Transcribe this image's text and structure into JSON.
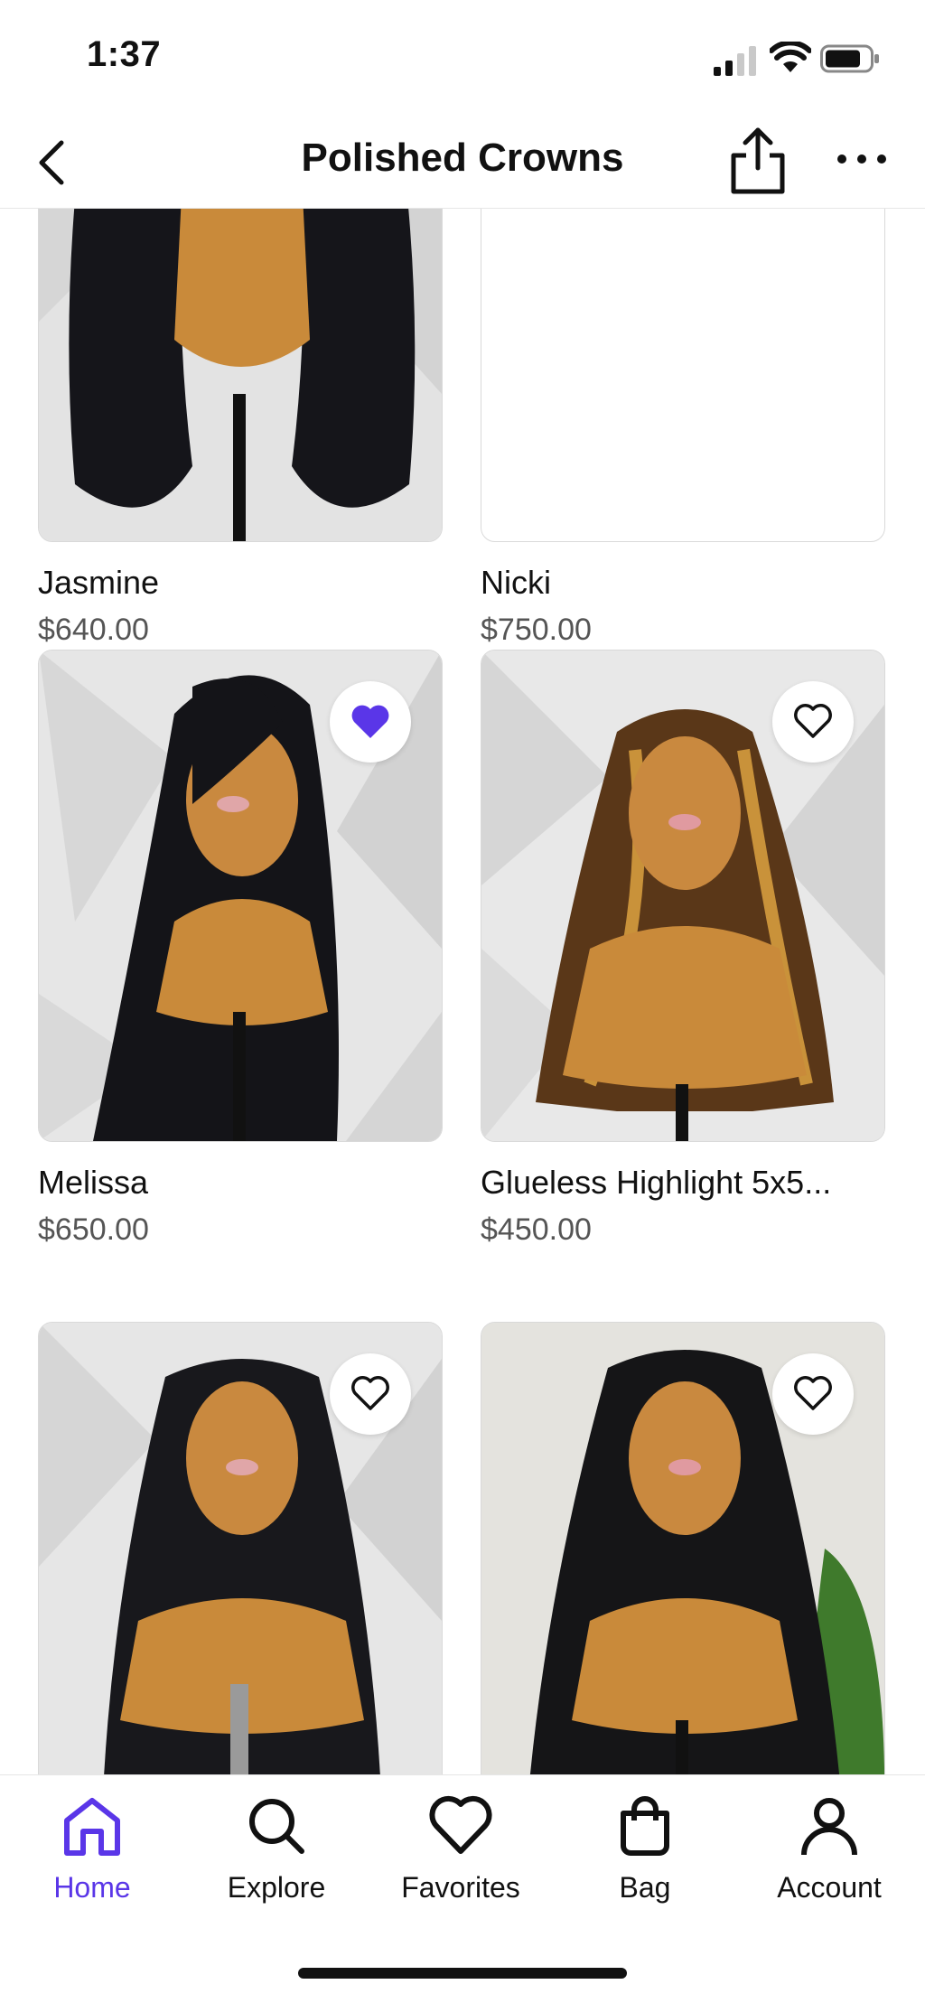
{
  "status_bar": {
    "time": "1:37"
  },
  "header": {
    "title": "Polished Crowns"
  },
  "products": [
    {
      "name": "Jasmine",
      "price": "$640.00",
      "favorited": null
    },
    {
      "name": "Nicki",
      "price": "$750.00",
      "favorited": null
    },
    {
      "name": "Melissa",
      "price": "$650.00",
      "favorited": true
    },
    {
      "name": "Glueless Highlight 5x5...",
      "price": "$450.00",
      "favorited": false
    },
    {
      "name": "",
      "price": "",
      "favorited": false
    },
    {
      "name": "",
      "price": "",
      "favorited": false
    }
  ],
  "nav": {
    "items": [
      {
        "label": "Home",
        "icon": "home-icon",
        "active": true
      },
      {
        "label": "Explore",
        "icon": "search-icon",
        "active": false
      },
      {
        "label": "Favorites",
        "icon": "heart-icon",
        "active": false
      },
      {
        "label": "Bag",
        "icon": "bag-icon",
        "active": false
      },
      {
        "label": "Account",
        "icon": "person-icon",
        "active": false
      }
    ]
  },
  "colors": {
    "accent": "#5a36e8",
    "text": "#111111",
    "price": "#555555"
  }
}
